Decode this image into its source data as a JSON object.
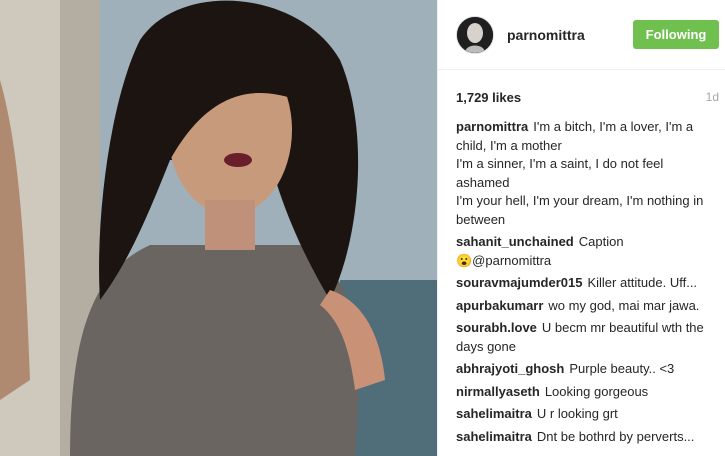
{
  "post": {
    "username": "parnomittra",
    "follow_label": "Following",
    "likes": "1,729 likes",
    "age": "1d",
    "caption": "I'm a bitch, I'm a lover, I'm a child, I'm a mother\nI'm a sinner, I'm a saint, I do not feel ashamed\nI'm your hell, I'm your dream, I'm nothing in between"
  },
  "comments": [
    {
      "user": "sahanit_unchained",
      "text": "Caption \n😮@parnomittra"
    },
    {
      "user": "souravmajumder015",
      "text": "Killer attitude. Uff..."
    },
    {
      "user": "apurbakumarr",
      "text": "wo my god, mai mar jawa."
    },
    {
      "user": "sourabh.love",
      "text": "U becm mr beautiful wth the days gone"
    },
    {
      "user": "abhrajyoti_ghosh",
      "text": "Purple beauty.. <3"
    },
    {
      "user": "nirmallyaseth",
      "text": "Looking gorgeous"
    },
    {
      "user": "sahelimaitra",
      "text": "U r looking grt"
    },
    {
      "user": "sahelimaitra",
      "text": "Dnt be bothrd by perverts..."
    }
  ],
  "colors": {
    "follow_button": "#70c050",
    "meta_text": "#a5a7aa"
  }
}
